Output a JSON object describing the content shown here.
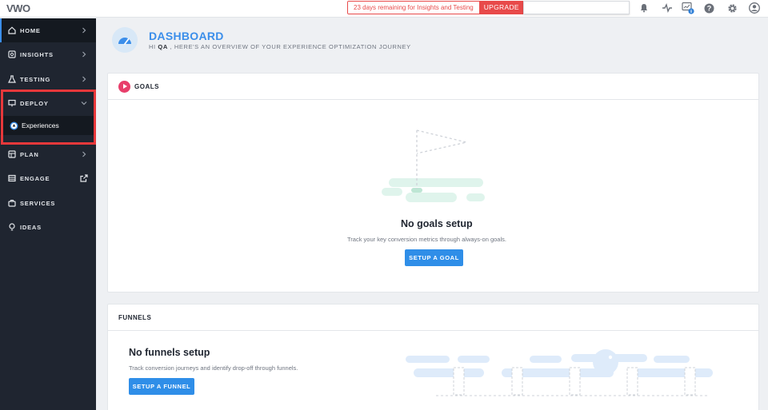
{
  "topbar": {
    "logo": "VWO",
    "trial_message": "23 days remaining for Insights and Testing",
    "upgrade_label": "UPGRADE",
    "icons": [
      "bell-icon",
      "activity-icon",
      "screen-info-icon",
      "help-icon",
      "settings-icon",
      "user-icon"
    ]
  },
  "sidebar": {
    "items": [
      {
        "label": "HOME",
        "icon": "home-icon"
      },
      {
        "label": "INSIGHTS",
        "icon": "insights-icon"
      },
      {
        "label": "TESTING",
        "icon": "flask-icon"
      },
      {
        "label": "DEPLOY",
        "icon": "deploy-icon"
      },
      {
        "label": "PLAN",
        "icon": "plan-icon"
      },
      {
        "label": "ENGAGE",
        "icon": "engage-icon"
      },
      {
        "label": "SERVICES",
        "icon": "services-icon"
      },
      {
        "label": "IDEAS",
        "icon": "bulb-icon"
      }
    ],
    "deploy_sub_item": "Experiences"
  },
  "header": {
    "title": "DASHBOARD",
    "greeting_prefix": "HI",
    "user": "QA",
    "greeting_suffix": ", HERE'S AN OVERVIEW OF YOUR EXPERIENCE OPTIMIZATION JOURNEY"
  },
  "goals": {
    "title": "GOALS",
    "empty_title": "No goals setup",
    "empty_desc": "Track your key conversion metrics through always-on goals.",
    "button": "SETUP A GOAL"
  },
  "funnels": {
    "title": "FUNNELS",
    "empty_title": "No funnels setup",
    "empty_desc": "Track conversion journeys and identify drop-off through funnels.",
    "button": "SETUP A FUNNEL"
  },
  "colors": {
    "accent": "#3b8eea",
    "sidebar": "#1f2530",
    "alert": "#e84a4a",
    "goals_badge": "#e83e6b",
    "highlight_box": "#e8383b"
  }
}
